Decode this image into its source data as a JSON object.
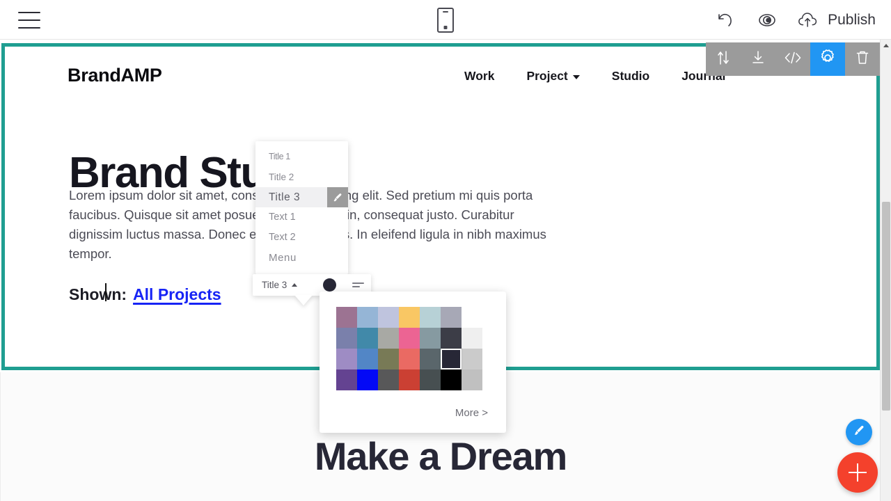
{
  "appbar": {
    "menu_icon": "hamburger-icon",
    "device_icon": "mobile-device-icon",
    "undo_icon": "undo-icon",
    "preview_icon": "eye-preview-icon",
    "publish_icon": "cloud-upload-icon",
    "publish_label": "Publish"
  },
  "block_toolbar": {
    "items": [
      {
        "name": "move-block",
        "icon": "arrows-up-down-icon",
        "active": false
      },
      {
        "name": "download-block",
        "icon": "download-icon",
        "active": false
      },
      {
        "name": "edit-code",
        "icon": "code-brackets-icon",
        "active": false
      },
      {
        "name": "block-settings",
        "icon": "gear-icon",
        "active": true
      },
      {
        "name": "delete-block",
        "icon": "trash-icon",
        "active": false
      }
    ],
    "active_color": "#2196f3",
    "bar_color": "#9b9b9b"
  },
  "site": {
    "logo": "BrandAMP",
    "nav": [
      {
        "label": "Work",
        "has_caret": false
      },
      {
        "label": "Project",
        "has_caret": true
      },
      {
        "label": "Studio",
        "has_caret": false
      },
      {
        "label": "Journal",
        "has_caret": false
      }
    ],
    "hero_title": "Brand Studio",
    "hero_body": "Lorem ipsum dolor sit amet, consectetur adipiscing elit. Sed pretium mi quis porta faucibus. Quisque sit amet posuere, varius justo in, consequat justo. Curabitur dignissim luctus massa. Donec eget eleifend felis. In eleifend ligula in nibh maximus tempor.",
    "shown_label": "Shown:",
    "shown_link": "All Projects",
    "lower_title": "Make a Dream",
    "link_color": "#1724f5",
    "selection_border_color": "#1f9e91"
  },
  "type_menu": {
    "items": [
      {
        "label": "Title 1",
        "selected": false,
        "cls": "t1"
      },
      {
        "label": "Title 2",
        "selected": false,
        "cls": "t2"
      },
      {
        "label": "Title 3",
        "selected": true,
        "cls": "t3"
      },
      {
        "label": "Text 1",
        "selected": false,
        "cls": "tx1"
      },
      {
        "label": "Text 2",
        "selected": false,
        "cls": "tx2"
      },
      {
        "label": "Menu",
        "selected": false,
        "cls": "tmn"
      }
    ],
    "brush_icon": "paintbrush-icon"
  },
  "inline_toolbar": {
    "selected_type": "Title 3",
    "caret_icon": "chevron-up-icon",
    "color_dot": "#272736",
    "align_icon": "align-lines-icon"
  },
  "color_picker": {
    "more_label": "More >",
    "selected_color": "#272736",
    "rows": [
      [
        "#9c7392",
        "#95b5d6",
        "#bfc4de",
        "#f9c764",
        "#b7d1d6",
        "#a7a8b6",
        "#ffffff"
      ],
      [
        "#7a80ab",
        "#4189a9",
        "#a8a9a4",
        "#ec6493",
        "#869aa1",
        "#3c3d47",
        "#efefef"
      ],
      [
        "#9e8cc4",
        "#5286c6",
        "#787a56",
        "#ea6a63",
        "#5a666b",
        "#272736",
        "#cbcbcb"
      ],
      [
        "#644391",
        "#0309f6",
        "#585859",
        "#cb4033",
        "#474f51",
        "#000000",
        "#c0c0c0"
      ]
    ]
  },
  "fabs": {
    "brush": {
      "icon": "paintbrush-icon",
      "color": "#2196f3"
    },
    "add": {
      "icon": "plus-icon",
      "color": "#f4412c"
    }
  },
  "scrollbar": {
    "up_icon": "caret-up-icon"
  }
}
